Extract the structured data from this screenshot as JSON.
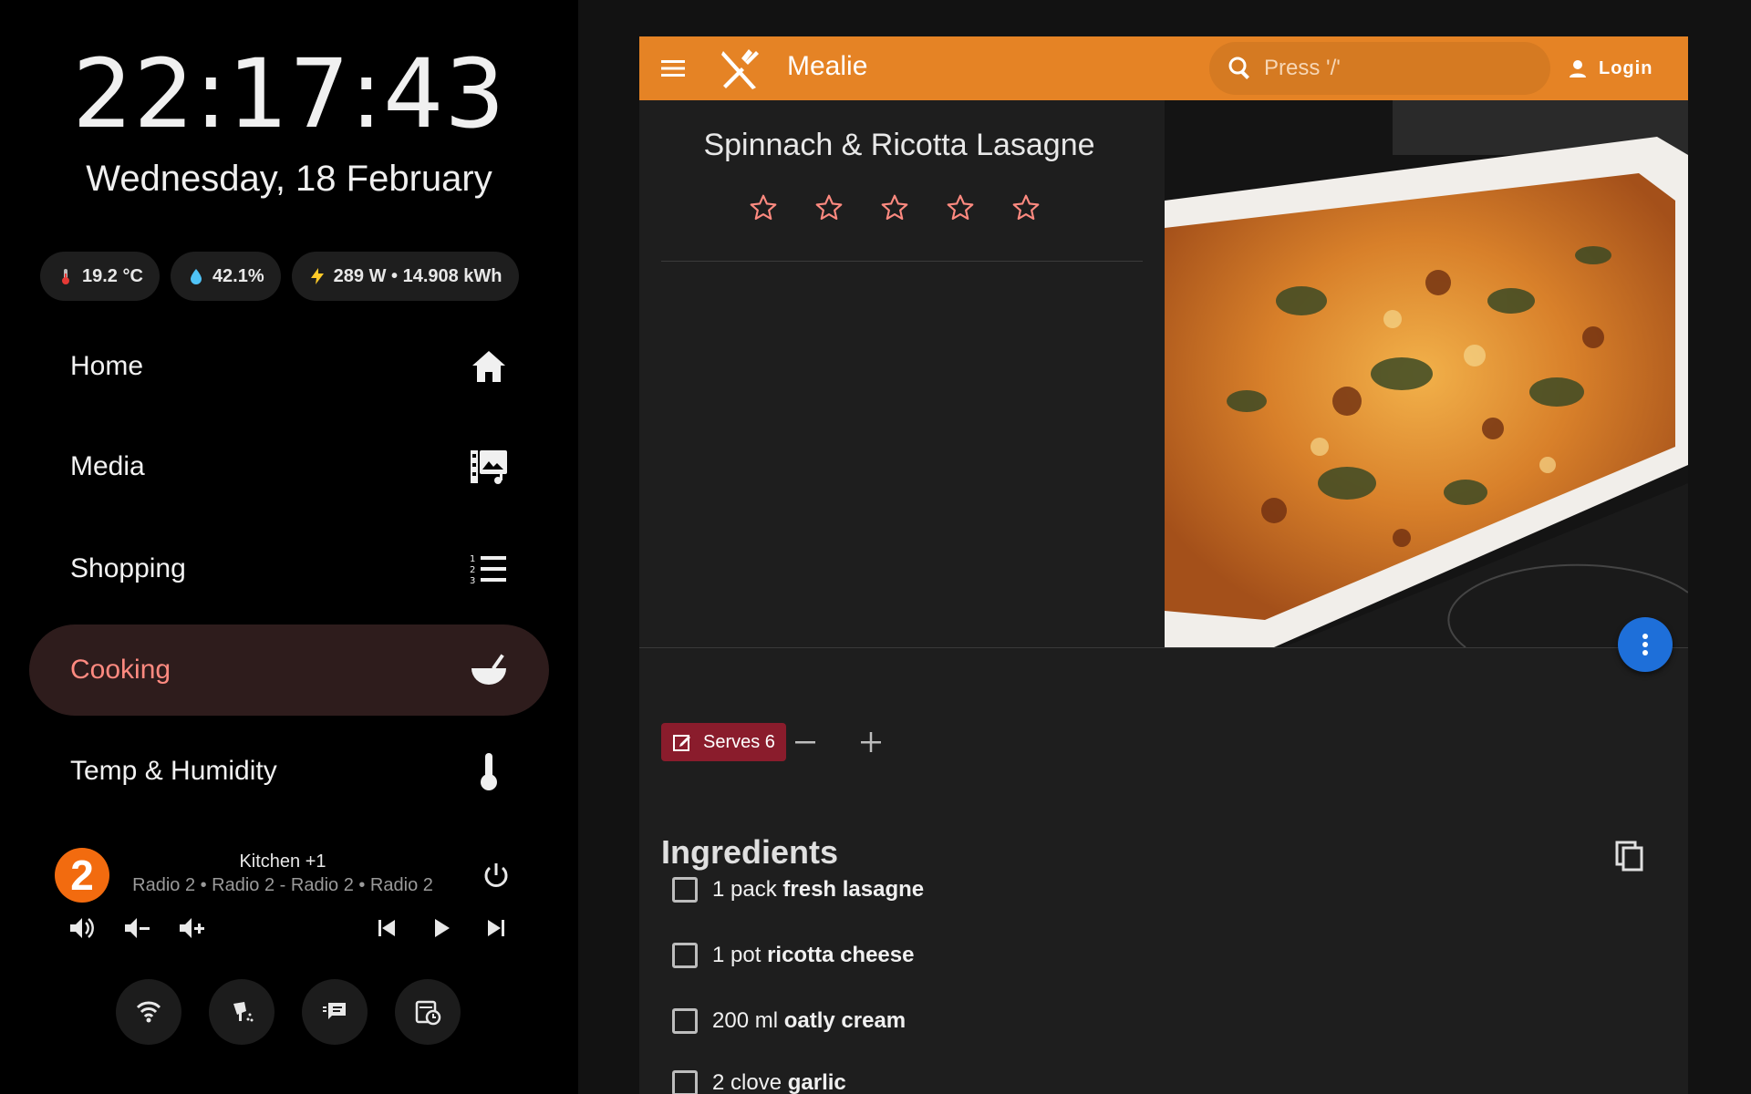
{
  "clock": {
    "time": "22:17:43",
    "date": "Wednesday, 18 February"
  },
  "sensors": {
    "temperature": "19.2 °C",
    "humidity": "42.1%",
    "power": "289 W • 14.908 kWh"
  },
  "nav": [
    {
      "label": "Home",
      "icon": "home-icon"
    },
    {
      "label": "Media",
      "icon": "media-library-icon"
    },
    {
      "label": "Shopping",
      "icon": "numbered-list-icon"
    },
    {
      "label": "Cooking",
      "icon": "bowl-icon",
      "active": true
    },
    {
      "label": "Temp & Humidity",
      "icon": "thermometer-icon"
    }
  ],
  "media_player": {
    "badge": "2",
    "title": "Kitchen +1",
    "subtitle": "Radio 2 • Radio 2 - Radio 2 • Radio 2"
  },
  "quick_actions": [
    "wifi-icon",
    "vacuum-icon",
    "message-icon",
    "schedule-icon"
  ],
  "mealie": {
    "app_name": "Mealie",
    "search_placeholder": "Press '/'",
    "login_label": "Login",
    "recipe_title": "Spinnach & Ricotta Lasagne",
    "rating": 0,
    "rating_max": 5,
    "serves_label": "Serves 6",
    "ingredients_heading": "Ingredients",
    "ingredients": [
      {
        "qty": "1 pack",
        "name": "fresh lasagne"
      },
      {
        "qty": "1 pot",
        "name": "ricotta cheese"
      },
      {
        "qty": "200 ml",
        "name": "oatly cream"
      },
      {
        "qty": "2 clove",
        "name": "garlic"
      }
    ]
  },
  "colors": {
    "accent": "#e58325",
    "active_nav_bg": "#2e1c1c",
    "active_nav_text": "#ff8a80",
    "serves_chip": "#8a1c2c",
    "fab": "#1e6fd9",
    "badge": "#f26b0f"
  }
}
